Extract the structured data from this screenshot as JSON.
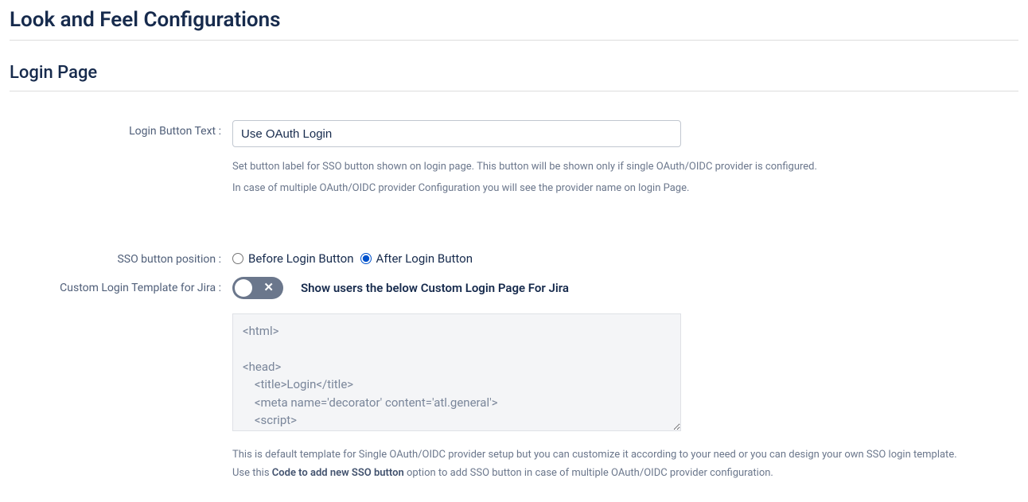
{
  "page_title": "Look and Feel Configurations",
  "section_title": "Login Page",
  "login_button_text": {
    "label": "Login Button Text :",
    "value": "Use OAuth Login",
    "help1": "Set button label for SSO button shown on login page. This button will be shown only if single OAuth/OIDC provider is configured.",
    "help2": "In case of multiple OAuth/OIDC provider Configuration you will see the provider name on login Page."
  },
  "sso_position": {
    "label": "SSO button position :",
    "options": {
      "before": "Before Login Button",
      "after": "After Login Button"
    },
    "selected": "after"
  },
  "custom_template": {
    "label": "Custom Login Template for Jira :",
    "toggle_state": "off",
    "toggle_text": "Show users the below Custom Login Page For Jira",
    "code": "<html>\n\n<head>\n    <title>Login</title>\n    <meta name='decorator' content='atl.general'>\n    <script>",
    "desc1": "This is default template for Single OAuth/OIDC provider setup but you can customize it according to your need or you can design your own SSO login template.",
    "desc2_pre": "Use this ",
    "desc2_bold": "Code to add new SSO button",
    "desc2_post": " option to add SSO button in case of multiple OAuth/OIDC provider configuration."
  }
}
